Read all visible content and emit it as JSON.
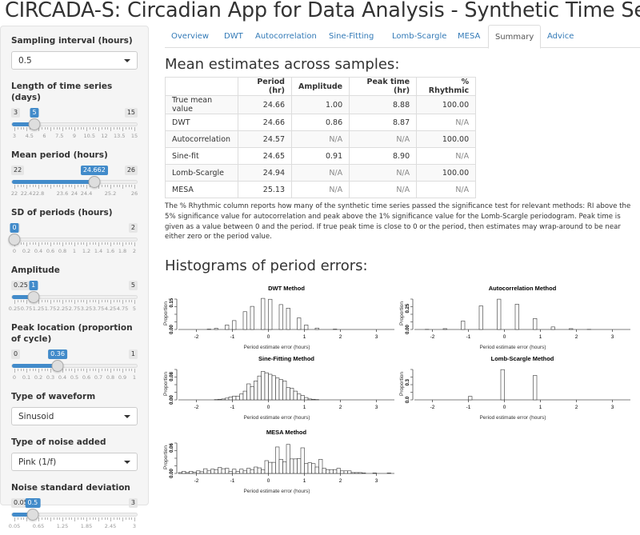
{
  "app_title": "CIRCADA-S: Circadian App for Data Analysis - Synthetic Time Series",
  "sidebar": {
    "sampling_interval": {
      "label": "Sampling interval (hours)",
      "value": "0.5"
    },
    "length_days": {
      "label": "Length of time series (days)",
      "min": "3",
      "max": "15",
      "value": "5",
      "fraction": 0.1667,
      "tick_labels": [
        "3",
        "4.5",
        "6",
        "7.5",
        "9",
        "10.5",
        "12",
        "13.5",
        "15"
      ]
    },
    "mean_period": {
      "label": "Mean period (hours)",
      "min": "22",
      "max": "26",
      "value": "24.662",
      "fraction": 0.6655,
      "tick_labels": [
        "22",
        "22.4",
        "22.8",
        "",
        "23.6",
        "24",
        "24.4",
        "",
        "25.2",
        "",
        "26"
      ]
    },
    "sd_periods": {
      "label": "SD of periods (hours)",
      "min": "0",
      "max": "2",
      "value": "0",
      "fraction": 0,
      "tick_labels": [
        "0",
        "0.2",
        "0.4",
        "0.6",
        "0.8",
        "1",
        "1.2",
        "1.4",
        "1.6",
        "1.8",
        "2"
      ]
    },
    "amplitude": {
      "label": "Amplitude",
      "min": "0.25",
      "max": "5",
      "value": "1",
      "fraction": 0.158,
      "tick_labels": [
        "0.25",
        "0.75",
        "1.25",
        "1.75",
        "2.25",
        "2.75",
        "3.25",
        "3.75",
        "4.25",
        "4.75",
        "5"
      ]
    },
    "peak_location": {
      "label": "Peak location (proportion of cycle)",
      "min": "0",
      "max": "1",
      "value": "0.36",
      "fraction": 0.36,
      "tick_labels": [
        "0",
        "0.1",
        "0.2",
        "0.3",
        "0.4",
        "0.5",
        "0.6",
        "0.7",
        "0.8",
        "0.9",
        "1"
      ]
    },
    "waveform": {
      "label": "Type of waveform",
      "value": "Sinusoid"
    },
    "noise_type": {
      "label": "Type of noise added",
      "value": "Pink (1/f)"
    },
    "noise_sd": {
      "label": "Noise standard deviation",
      "min": "0.05",
      "max": "3",
      "value": "0.5",
      "fraction": 0.1525,
      "tick_labels": [
        "0.05",
        "0.65",
        "1.25",
        "1.85",
        "2.45",
        "3"
      ]
    }
  },
  "tabs": [
    {
      "label": "Overview",
      "active": false
    },
    {
      "label": "DWT",
      "active": false
    },
    {
      "label": "Autocorrelation",
      "active": false
    },
    {
      "label": "Sine-Fitting",
      "active": false
    },
    {
      "label": "Lomb-Scargle",
      "active": false
    },
    {
      "label": "MESA",
      "active": false
    },
    {
      "label": "Summary",
      "active": true
    },
    {
      "label": "Advice",
      "active": false
    }
  ],
  "summary": {
    "heading": "Mean estimates across samples:",
    "columns": [
      "",
      "Period (hr)",
      "Amplitude",
      "Peak time (hr)",
      "% Rhythmic"
    ],
    "rows": [
      [
        "True mean value",
        "24.66",
        "1.00",
        "8.88",
        "100.00"
      ],
      [
        "DWT",
        "24.66",
        "0.86",
        "8.87",
        "N/A"
      ],
      [
        "Autocorrelation",
        "24.57",
        "N/A",
        "N/A",
        "100.00"
      ],
      [
        "Sine-fit",
        "24.65",
        "0.91",
        "8.90",
        "N/A"
      ],
      [
        "Lomb-Scargle",
        "24.94",
        "N/A",
        "N/A",
        "100.00"
      ],
      [
        "MESA",
        "25.13",
        "N/A",
        "N/A",
        "N/A"
      ]
    ],
    "note": "The % Rhythmic column reports how many of the synthetic time series passed the significance test for relevant methods: RI above the 5% significance value for autocorrelation and peak above the 1% significance value for the Lomb-Scargle periodogram. Peak time is given as a value between 0 and the period. If true peak time is close to 0 or the period, then estimates may wrap-around to be near either zero or the period value.",
    "hist_heading": "Histograms of period errors:"
  },
  "chart_data": [
    {
      "type": "bar",
      "title": "DWT Method",
      "xlabel": "Period estimate error (hours)",
      "ylabel": "Proportion",
      "xlim": [
        -2.5,
        3.5
      ],
      "xticks": [
        "-2",
        "-1",
        "0",
        "1",
        "2",
        "3"
      ],
      "ylim": [
        0,
        0.18
      ],
      "yticks": [
        "0.00",
        "0.15"
      ],
      "bin_width": 0.1,
      "x": [
        -1.65,
        -1.45,
        -1.15,
        -0.95,
        -0.65,
        -0.45,
        -0.15,
        0.05,
        0.35,
        0.55,
        0.85,
        1.05,
        1.35,
        1.85
      ],
      "values": [
        0.002,
        0.006,
        0.025,
        0.05,
        0.1,
        0.13,
        0.175,
        0.17,
        0.14,
        0.12,
        0.065,
        0.025,
        0.008,
        0.002
      ]
    },
    {
      "type": "bar",
      "title": "Autocorrelation Method",
      "xlabel": "Period estimate error (hours)",
      "ylabel": "Proportion",
      "xlim": [
        -2.5,
        3.5
      ],
      "xticks": [
        "-2",
        "-1",
        "0",
        "1",
        "2",
        "3"
      ],
      "ylim": [
        0,
        0.38
      ],
      "yticks": [
        "0.00",
        "0.25"
      ],
      "bin_width": 0.1,
      "x": [
        -2.15,
        -1.65,
        -1.15,
        -0.65,
        -0.15,
        0.35,
        0.85,
        1.35,
        1.85,
        2.35
      ],
      "values": [
        0.002,
        0.01,
        0.1,
        0.28,
        0.36,
        0.3,
        0.13,
        0.03,
        0.01,
        0.002
      ]
    },
    {
      "type": "bar",
      "title": "Sine-Fitting Method",
      "xlabel": "Period estimate error (hours)",
      "ylabel": "Proportion",
      "xlim": [
        -2.5,
        3.5
      ],
      "xticks": [
        "-2",
        "-1",
        "0",
        "1",
        "2",
        "3"
      ],
      "ylim": [
        0,
        0.11
      ],
      "yticks": [
        "0.00",
        "0.08"
      ],
      "bin_width": 0.1,
      "x": [
        -1.45,
        -1.35,
        -1.25,
        -1.15,
        -1.05,
        -0.95,
        -0.85,
        -0.75,
        -0.65,
        -0.55,
        -0.45,
        -0.35,
        -0.25,
        -0.15,
        -0.05,
        0.05,
        0.15,
        0.25,
        0.35,
        0.45,
        0.55,
        0.65,
        0.75,
        0.85,
        0.95,
        1.05,
        1.15,
        1.25,
        1.35
      ],
      "values": [
        0.001,
        0.002,
        0.003,
        0.006,
        0.01,
        0.013,
        0.013,
        0.02,
        0.03,
        0.055,
        0.045,
        0.065,
        0.082,
        0.098,
        0.093,
        0.088,
        0.083,
        0.075,
        0.07,
        0.065,
        0.042,
        0.04,
        0.03,
        0.02,
        0.015,
        0.008,
        0.003,
        0.002,
        0.001
      ]
    },
    {
      "type": "bar",
      "title": "Lomb-Scargle Method",
      "xlabel": "Period estimate error (hours)",
      "ylabel": "Proportion",
      "xlim": [
        -2.5,
        3.5
      ],
      "xticks": [
        "-2",
        "-1",
        "0",
        "1",
        "2",
        "3"
      ],
      "ylim": [
        0,
        0.55
      ],
      "yticks": [
        "0.0",
        "0.3"
      ],
      "bin_width": 0.1,
      "x": [
        -0.95,
        -0.05,
        0.85
      ],
      "values": [
        0.06,
        0.52,
        0.42
      ]
    },
    {
      "type": "bar",
      "title": "MESA Method",
      "xlabel": "Period estimate error (hours)",
      "ylabel": "Proportion",
      "xlim": [
        -2.5,
        3.5
      ],
      "xticks": [
        "-2",
        "-1",
        "0",
        "1",
        "2",
        "3"
      ],
      "ylim": [
        0,
        0.075
      ],
      "yticks": [
        "0.00",
        "0.06"
      ],
      "bin_width": 0.1,
      "x": [
        -2.45,
        -2.35,
        -2.25,
        -2.15,
        -2.05,
        -1.95,
        -1.85,
        -1.75,
        -1.65,
        -1.55,
        -1.45,
        -1.35,
        -1.25,
        -1.15,
        -1.05,
        -0.95,
        -0.85,
        -0.75,
        -0.65,
        -0.55,
        -0.45,
        -0.35,
        -0.25,
        -0.15,
        -0.05,
        0.05,
        0.15,
        0.25,
        0.35,
        0.45,
        0.55,
        0.65,
        0.75,
        0.85,
        0.95,
        1.05,
        1.15,
        1.25,
        1.35,
        1.45,
        1.55,
        1.65,
        1.75,
        1.85,
        1.95,
        2.05,
        2.15,
        2.25,
        2.35,
        2.45,
        2.55,
        2.65,
        2.75,
        2.85,
        2.95,
        3.35
      ],
      "values": [
        0.002,
        0.005,
        0.002,
        0.005,
        0.003,
        0.006,
        0.004,
        0.011,
        0.006,
        0.01,
        0.009,
        0.014,
        0.011,
        0.012,
        0.005,
        0.01,
        0.005,
        0.01,
        0.006,
        0.012,
        0.009,
        0.015,
        0.013,
        0.009,
        0.03,
        0.026,
        0.026,
        0.062,
        0.033,
        0.027,
        0.068,
        0.034,
        0.034,
        0.035,
        0.06,
        0.023,
        0.025,
        0.023,
        0.015,
        0.033,
        0.012,
        0.009,
        0.009,
        0.009,
        0.012,
        0.006,
        0.006,
        0.006,
        0.002,
        0.002,
        0.002,
        0.001,
        0,
        0,
        0.001,
        0.001
      ]
    }
  ]
}
